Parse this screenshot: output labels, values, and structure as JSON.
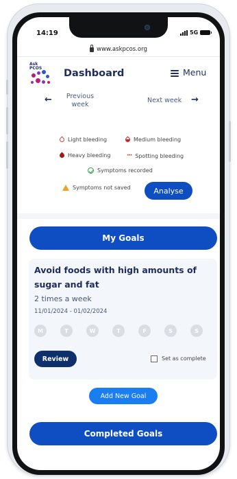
{
  "status_bar": {
    "time": "14:19",
    "network": "5G"
  },
  "browser": {
    "url": "www.askpcos.org"
  },
  "header": {
    "logo_text_line1": "Ask",
    "logo_text_line2": "PCOS",
    "title": "Dashboard",
    "menu_label": "Menu"
  },
  "week_nav": {
    "previous_line1": "Previous",
    "previous_line2": "week",
    "next_label": "Next week"
  },
  "legend": {
    "light": "Light bleeding",
    "medium": "Medium bleeding",
    "heavy": "Heavy bleeding",
    "spotting": "Spotting bleeding",
    "recorded": "Symptoms recorded",
    "not_saved": "Symptoms not saved"
  },
  "analyse_label": "Analyse",
  "my_goals_label": "My Goals",
  "goal": {
    "title": "Avoid foods with high amounts of sugar and fat",
    "frequency": "2 times a week",
    "dates": "11/01/2024 - 01/02/2024",
    "days": [
      "M",
      "T",
      "W",
      "T",
      "F",
      "S",
      "S"
    ],
    "review_label": "Review",
    "complete_label": "Set as complete"
  },
  "add_goal_label": "Add New Goal",
  "completed_goals_label": "Completed Goals",
  "colors": {
    "primary": "#0f4ec2",
    "review": "#0d2f6b",
    "add": "#1a7ef0",
    "bleeding": "#a01818",
    "recorded": "#36a152",
    "warning": "#f0a12a"
  }
}
